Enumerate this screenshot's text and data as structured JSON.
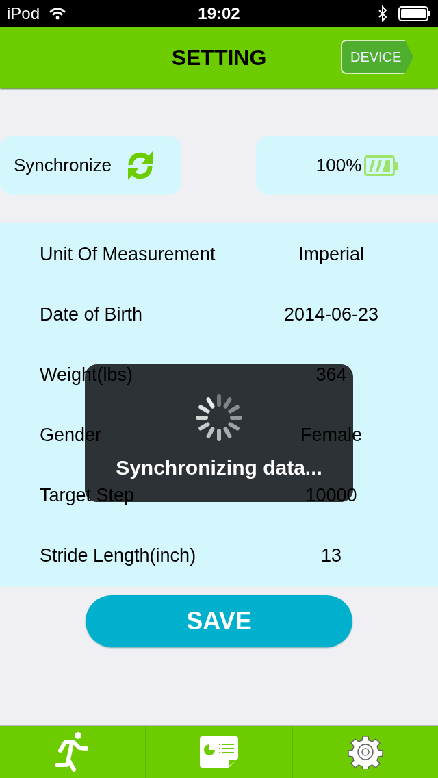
{
  "status_bar": {
    "carrier": "iPod",
    "time": "19:02"
  },
  "nav_bar": {
    "title": "SETTING",
    "device_button": "DEVICE"
  },
  "sync_card": {
    "label": "Synchronize"
  },
  "battery_card": {
    "reading": "100%"
  },
  "settings": [
    {
      "label": "Unit Of Measurement",
      "value": "Imperial"
    },
    {
      "label": "Date of Birth",
      "value": "2014-06-23"
    },
    {
      "label": "Weight(lbs)",
      "value": "364"
    },
    {
      "label": "Gender",
      "value": "Female"
    },
    {
      "label": "Target Step",
      "value": "10000"
    },
    {
      "label": "Stride Length(inch)",
      "value": "13"
    }
  ],
  "save_button": "SAVE",
  "progress_overlay": {
    "message": "Synchronizing data..."
  },
  "tab_bar": [
    {
      "kind": "run"
    },
    {
      "kind": "report"
    },
    {
      "kind": "settings"
    }
  ]
}
